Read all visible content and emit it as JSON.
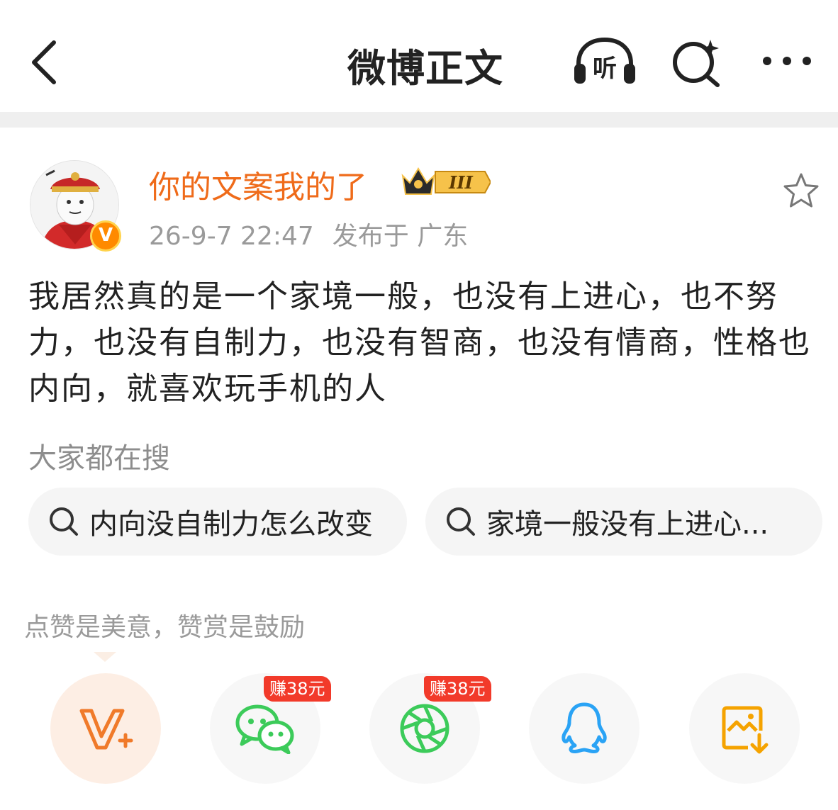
{
  "header": {
    "title": "微博正文",
    "listen_label": "听"
  },
  "post": {
    "username": "你的文案我的了",
    "member_level": "III",
    "verify_mark": "V",
    "timestamp": "26-9-7 22:47",
    "location": "发布于 广东",
    "text": "我居然真的是一个家境一般，也没有上进心，也不努力，也没有自制力，也没有智商，也没有情商，性格也内向，就喜欢玩手机的人"
  },
  "search": {
    "hint": "大家都在搜",
    "pills": [
      "内向没自制力怎么改变",
      "家境一般没有上进心..."
    ]
  },
  "reward": {
    "hint": "点赞是美意，赞赏是鼓励",
    "wechat_tag": "赚38元",
    "moments_tag": "赚38元"
  },
  "colors": {
    "accent_orange": "#ef6b1a",
    "wechat_green": "#3ccb5a",
    "qq_blue": "#2aa3f5",
    "save_orange": "#f5a300",
    "earn_red": "#f23a2a"
  }
}
